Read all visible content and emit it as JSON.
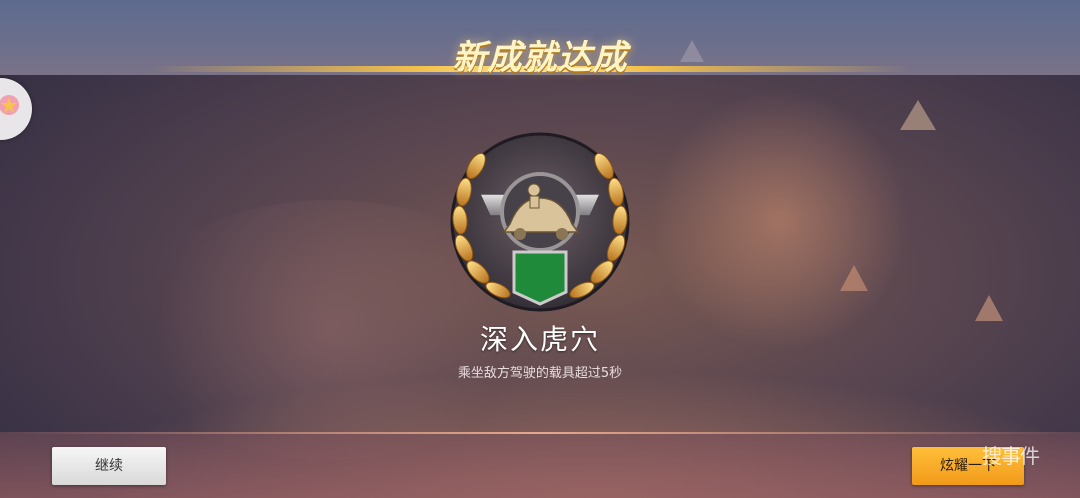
{
  "banner": {
    "title": "新成就达成"
  },
  "achievement": {
    "name": "深入虎穴",
    "description": "乘坐敌方驾驶的载具超过5秒",
    "emblem_icon": "vehicle-medal-icon"
  },
  "actions": {
    "continue_label": "继续",
    "share_label": "炫耀一下"
  },
  "overlay": {
    "watermark_text": "搜事件"
  },
  "colors": {
    "accent_gold": "#f2c04c",
    "share_button": "#f8ab2a",
    "continue_button": "#e8e8e8"
  }
}
